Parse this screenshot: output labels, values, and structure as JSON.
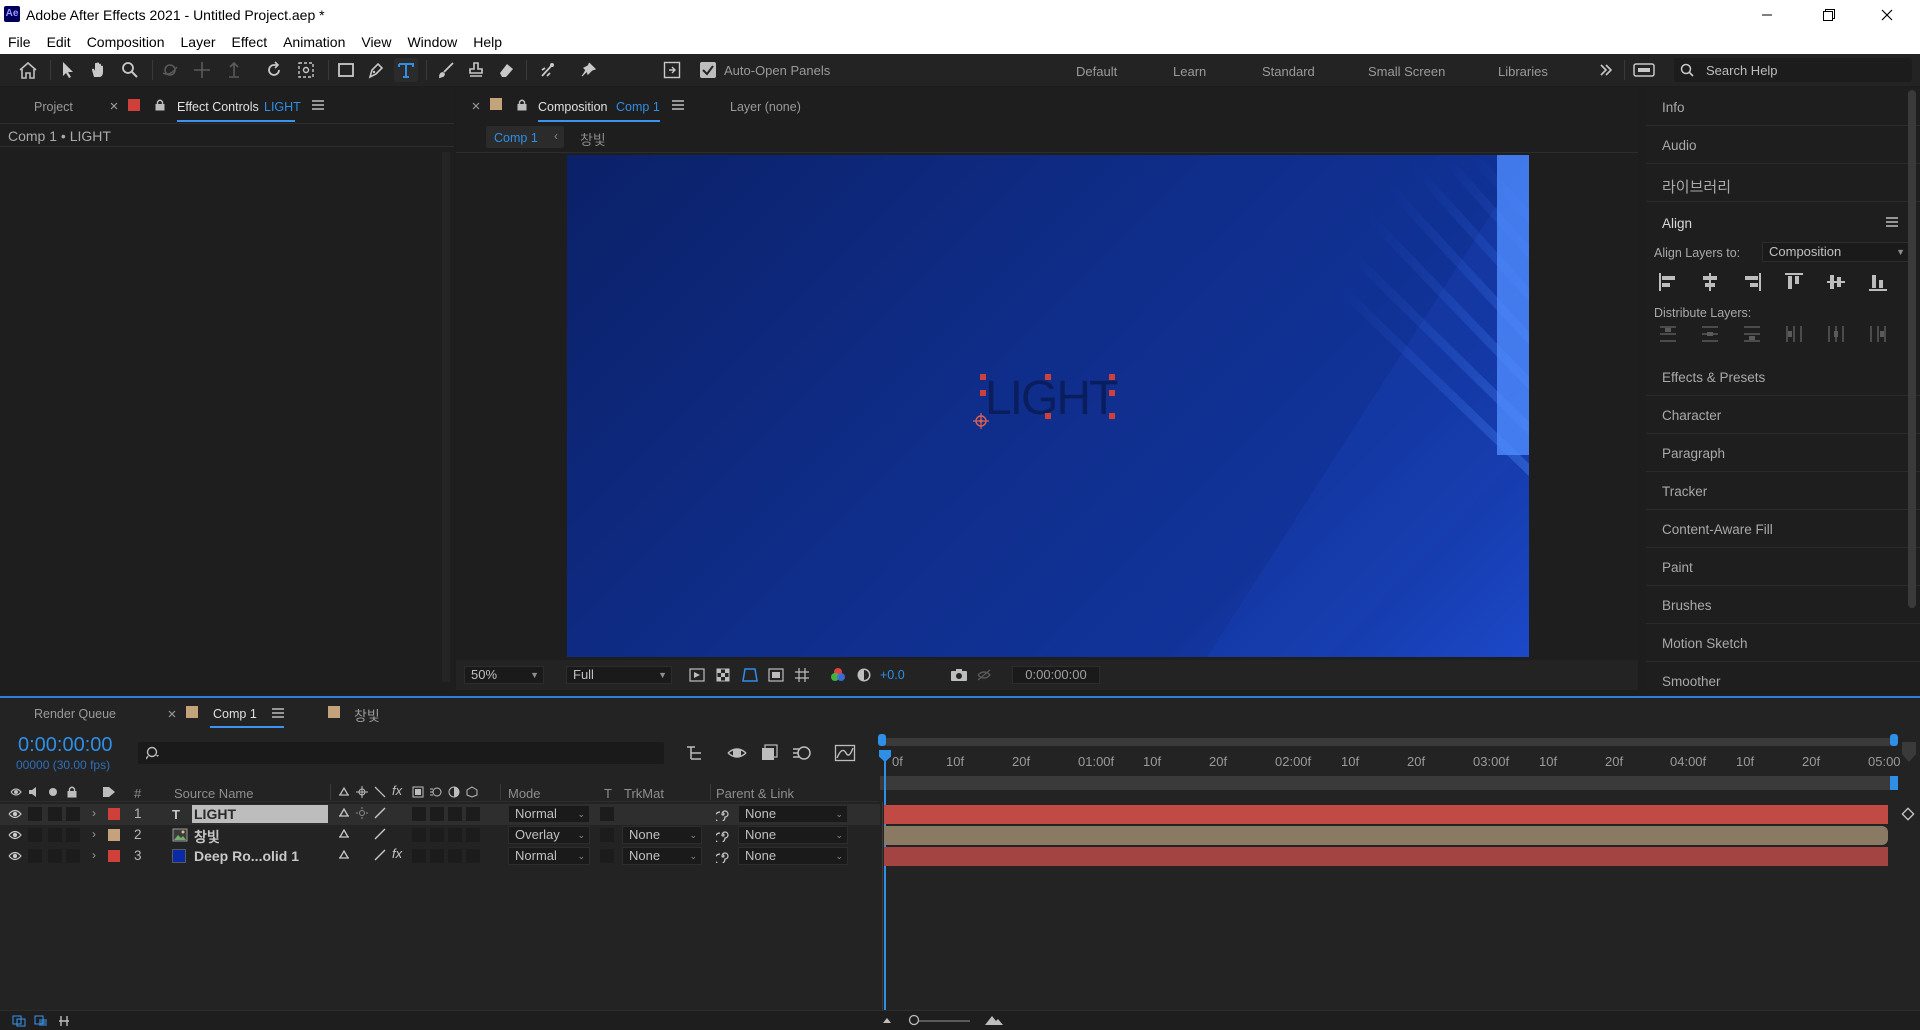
{
  "titlebar": {
    "app_icon": "Ae",
    "title": "Adobe After Effects 2021 - Untitled Project.aep *",
    "buttons": [
      "minimize-icon",
      "restore-icon",
      "close-icon"
    ]
  },
  "menu": [
    "File",
    "Edit",
    "Composition",
    "Layer",
    "Effect",
    "Animation",
    "View",
    "Window",
    "Help"
  ],
  "toolbar": {
    "auto_open_label": "Auto-Open Panels",
    "auto_open_checked": true,
    "workspaces": [
      "Default",
      "Learn",
      "Standard",
      "Small Screen",
      "Libraries"
    ],
    "search_placeholder": "Search Help"
  },
  "left_panel": {
    "tab_project": "Project",
    "tab_effect_controls": "Effect Controls",
    "tab_effect_controls_layer": "LIGHT",
    "breadcrumb": "Comp 1 • LIGHT"
  },
  "comp_panel": {
    "tab_composition": "Composition",
    "tab_composition_name": "Comp 1",
    "tab_layer": "Layer (none)",
    "subtab_comp": "Comp 1",
    "subtab_other": "창빛",
    "canvas_text": "LIGHT",
    "zoom": "50%",
    "resolution": "Full",
    "exposure": "+0.0",
    "timecode": "0:00:00:00",
    "bg_color": "#0d2a80",
    "light_color": "#3a7cff"
  },
  "right_panel": {
    "items_top": [
      "Info",
      "Audio",
      "라이브러리"
    ],
    "align_title": "Align",
    "align_to_label": "Align Layers to:",
    "align_to_value": "Composition",
    "distribute_label": "Distribute Layers:",
    "items_bottom": [
      "Effects & Presets",
      "Character",
      "Paragraph",
      "Tracker",
      "Content-Aware Fill",
      "Paint",
      "Brushes",
      "Motion Sketch",
      "Smoother"
    ]
  },
  "timeline": {
    "tab_render": "Render Queue",
    "tab_comp": "Comp 1",
    "tab_other": "창빛",
    "timecode": "0:00:00:00",
    "fps": "00000 (30.00 fps)",
    "search_placeholder": "",
    "headers": {
      "num": "#",
      "source": "Source Name",
      "mode": "Mode",
      "t": "T",
      "trkmat": "TrkMat",
      "parent": "Parent & Link"
    },
    "ruler": [
      "0f",
      "10f",
      "20f",
      "01:00f",
      "10f",
      "20f",
      "02:00f",
      "10f",
      "20f",
      "03:00f",
      "10f",
      "20f",
      "04:00f",
      "10f",
      "20f",
      "05:00"
    ],
    "layers": [
      {
        "num": "1",
        "type": "T",
        "name": "LIGHT",
        "label_color": "#d0403a",
        "mode": "Normal",
        "trkmat": "",
        "parent": "None",
        "bar_color": "#c24a45",
        "selected": true
      },
      {
        "num": "2",
        "type": "img",
        "name": "창빛",
        "label_color": "#c4a27c",
        "mode": "Overlay",
        "trkmat": "None",
        "parent": "None",
        "bar_color": "#8a7a64",
        "selected": false
      },
      {
        "num": "3",
        "type": "solid",
        "name": "Deep Ro...olid 1",
        "label_color": "#d0403a",
        "mode": "Normal",
        "trkmat": "None",
        "parent": "None",
        "bar_color": "#a34442",
        "selected": false
      }
    ]
  }
}
